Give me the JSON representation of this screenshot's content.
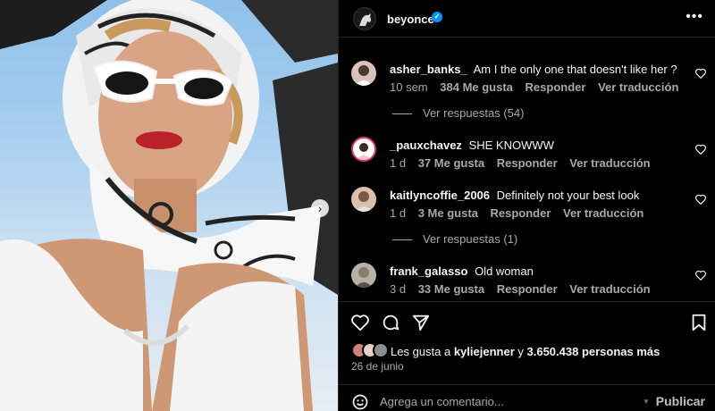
{
  "post": {
    "username": "beyonce",
    "verified_mark": "✓",
    "more_label": "•••"
  },
  "comments": [
    {
      "username": "asher_banks_",
      "text": "Am I the only one that doesn't like her ?",
      "time": "10 sem",
      "likes": "384 Me gusta",
      "reply": "Responder",
      "translate": "Ver traducción",
      "replies_label": "Ver respuestas (54)"
    },
    {
      "username": "_pauxchavez",
      "text": "SHE KNOWWW",
      "time": "1 d",
      "likes": "37 Me gusta",
      "reply": "Responder",
      "translate": "Ver traducción"
    },
    {
      "username": "kaitlyncoffie_2006",
      "text": "Definitely not your best look",
      "time": "1 d",
      "likes": "3 Me gusta",
      "reply": "Responder",
      "translate": "Ver traducción",
      "replies_label": "Ver respuestas (1)"
    },
    {
      "username": "frank_galasso",
      "text": "Old woman",
      "time": "3 d",
      "likes": "33 Me gusta",
      "reply": "Responder",
      "translate": "Ver traducción"
    }
  ],
  "likes_summary": {
    "prefix": "Les gusta a ",
    "user": "kyliejenner",
    "middle": " y ",
    "count": "3.650.438 personas más"
  },
  "date": "26 de junio",
  "add_comment": {
    "placeholder": "Agrega un comentario...",
    "publish": "Publicar"
  },
  "next_arrow": "›",
  "colors": {
    "background": "#000000",
    "secondary_text": "#a8a8a8",
    "verified": "#0095f6",
    "divider": "#262626"
  },
  "icons": [
    "heart-icon",
    "comment-icon",
    "share-icon",
    "bookmark-icon",
    "emoji-icon",
    "more-icon",
    "chevron-right-icon"
  ]
}
